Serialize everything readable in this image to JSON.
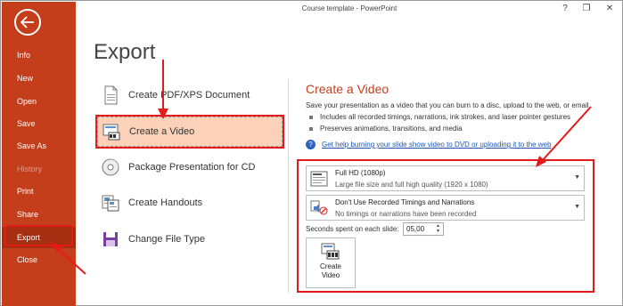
{
  "window": {
    "title": "Course template - PowerPoint",
    "controls": [
      "?",
      "❐",
      "✕"
    ]
  },
  "sidebar": {
    "back_icon": "back-arrow-icon",
    "items": [
      {
        "label": "Info",
        "state": "normal"
      },
      {
        "label": "New",
        "state": "normal"
      },
      {
        "label": "Open",
        "state": "normal"
      },
      {
        "label": "Save",
        "state": "normal"
      },
      {
        "label": "Save As",
        "state": "normal"
      },
      {
        "label": "History",
        "state": "disabled"
      },
      {
        "label": "Print",
        "state": "normal"
      },
      {
        "label": "Share",
        "state": "normal"
      },
      {
        "label": "Export",
        "state": "selected"
      },
      {
        "label": "Close",
        "state": "normal"
      }
    ],
    "background_color": "#c43e1c"
  },
  "main": {
    "title": "Export",
    "options": [
      {
        "label": "Create PDF/XPS Document",
        "icon": "pdf-document-icon"
      },
      {
        "label": "Create a Video",
        "icon": "video-icon",
        "selected": true
      },
      {
        "label": "Package Presentation for CD",
        "icon": "cd-icon"
      },
      {
        "label": "Create Handouts",
        "icon": "handouts-icon"
      },
      {
        "label": "Change File Type",
        "icon": "file-type-icon"
      }
    ]
  },
  "panel": {
    "title": "Create a Video",
    "description": "Save your presentation as a video that you can burn to a disc, upload to the web, or email",
    "bullets": [
      "Includes all recorded timings, narrations, ink strokes, and laser pointer gestures",
      "Preserves animations, transitions, and media"
    ],
    "help_link": "Get help burning your slide show video to DVD or uploading it to the web",
    "quality_dropdown": {
      "main": "Full HD (1080p)",
      "sub": "Large file size and full high quality (1920 x 1080)"
    },
    "timings_dropdown": {
      "main": "Don't Use Recorded Timings and Narrations",
      "sub": "No timings or narrations have been recorded"
    },
    "seconds_label": "Seconds spent on each slide:",
    "seconds_value": "05,00",
    "create_button": {
      "line1": "Create",
      "line2": "Video"
    }
  },
  "colors": {
    "accent": "#c43e1c",
    "annotation": "#e41b1b",
    "selected_option": "#fbd2b9",
    "link": "#1c55b3"
  }
}
